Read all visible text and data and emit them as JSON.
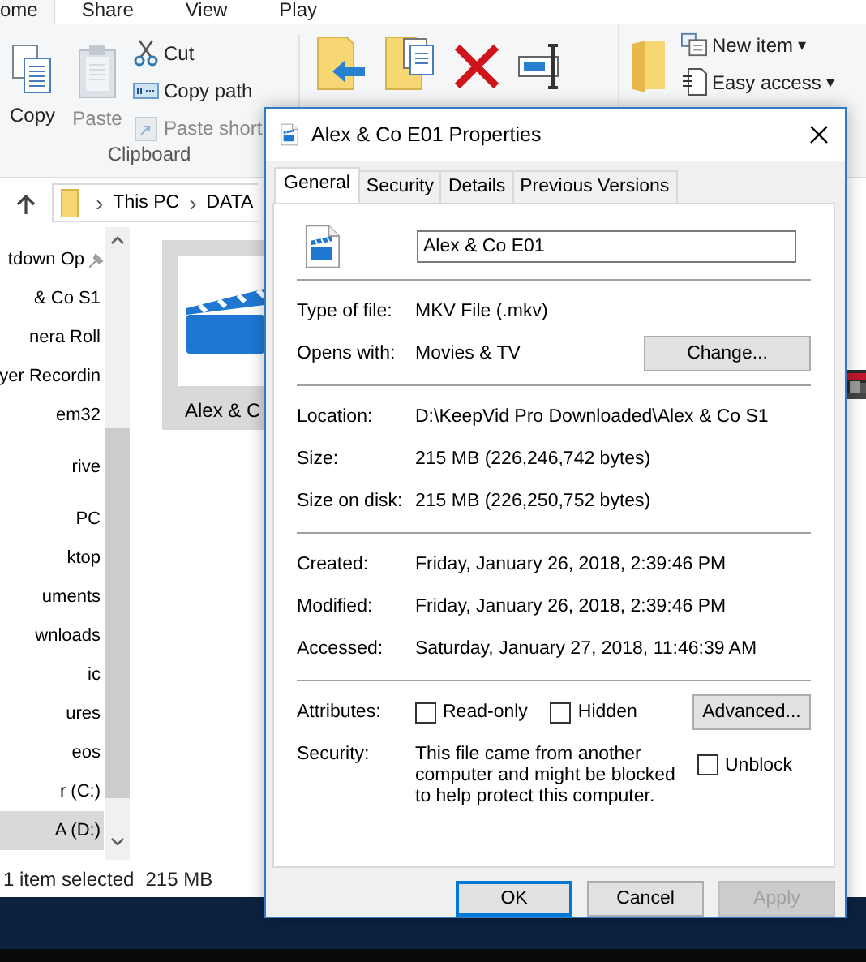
{
  "explorer": {
    "ribbon_tabs": [
      {
        "label": "ome",
        "selected": true
      },
      {
        "label": "Share",
        "selected": false
      },
      {
        "label": "View",
        "selected": false
      },
      {
        "label": "Play",
        "selected": false
      }
    ],
    "clipboard": {
      "large": [
        {
          "label": "Copy",
          "disabled": false
        },
        {
          "label": "Paste",
          "disabled": true
        }
      ],
      "small": [
        {
          "label": "Cut",
          "disabled": false
        },
        {
          "label": "Copy path",
          "disabled": false
        },
        {
          "label": "Paste short",
          "disabled": true
        }
      ],
      "group_label": "Clipboard"
    },
    "new_group": [
      {
        "label": "New item",
        "caret": "▾"
      },
      {
        "label": "Easy access",
        "caret": "▾"
      }
    ],
    "breadcrumbs": [
      {
        "separator": "›",
        "label": "This PC"
      },
      {
        "separator": "›",
        "label": "DATA"
      }
    ],
    "nav_groups": [
      [
        {
          "label": "tdown Op",
          "pinned": true,
          "selected": false
        },
        {
          "label": "& Co S1",
          "pinned": false,
          "selected": false
        },
        {
          "label": "nera Roll",
          "pinned": false,
          "selected": false
        },
        {
          "label": "yer Recordin",
          "pinned": false,
          "selected": false
        },
        {
          "label": "em32",
          "pinned": false,
          "selected": false
        }
      ],
      [
        {
          "label": "rive",
          "pinned": false,
          "selected": false
        }
      ],
      [
        {
          "label": "PC",
          "pinned": false,
          "selected": false
        },
        {
          "label": "ktop",
          "pinned": false,
          "selected": false
        },
        {
          "label": "uments",
          "pinned": false,
          "selected": false
        },
        {
          "label": "wnloads",
          "pinned": false,
          "selected": false
        },
        {
          "label": "ic",
          "pinned": false,
          "selected": false
        },
        {
          "label": "ures",
          "pinned": false,
          "selected": false
        },
        {
          "label": "eos",
          "pinned": false,
          "selected": false
        },
        {
          "label": "r (C:)",
          "pinned": false,
          "selected": false
        },
        {
          "label": "A (D:)",
          "pinned": false,
          "selected": true
        }
      ]
    ],
    "files": [
      {
        "name": "Alex & C",
        "selected": true
      }
    ],
    "status_bar": {
      "count": "1 item selected",
      "size": "215 MB"
    }
  },
  "dialog": {
    "title": "Alex & Co E01 Properties",
    "tabs": [
      {
        "label": "General",
        "selected": true
      },
      {
        "label": "Security",
        "selected": false
      },
      {
        "label": "Details",
        "selected": false
      },
      {
        "label": "Previous Versions",
        "selected": false
      }
    ],
    "name_field": {
      "value": "Alex & Co E01"
    },
    "sections": [
      [
        {
          "label": "Type of file:",
          "value": "MKV File (.mkv)"
        },
        {
          "label": "Opens with:",
          "value": "Movies & TV",
          "button": "Change..."
        }
      ],
      [
        {
          "label": "Location:",
          "value": "D:\\KeepVid Pro Downloaded\\Alex & Co S1"
        },
        {
          "label": "Size:",
          "value": "215 MB (226,246,742 bytes)"
        },
        {
          "label": "Size on disk:",
          "value": "215 MB (226,250,752 bytes)"
        }
      ],
      [
        {
          "label": "Created:",
          "value": "Friday, January 26, 2018, 2:39:46 PM"
        },
        {
          "label": "Modified:",
          "value": "Friday, January 26, 2018, 2:39:46 PM"
        },
        {
          "label": "Accessed:",
          "value": "Saturday, January 27, 2018, 11:46:39 AM"
        }
      ]
    ],
    "attributes": {
      "label": "Attributes:",
      "checkboxes": [
        {
          "label": "Read-only",
          "checked": false
        },
        {
          "label": "Hidden",
          "checked": false
        }
      ],
      "button": "Advanced..."
    },
    "security": {
      "label": "Security:",
      "text": "This file came from another computer and might be blocked to help protect this computer.",
      "unblock": {
        "label": "Unblock",
        "checked": false
      }
    },
    "buttons": [
      {
        "label": "OK",
        "default": true,
        "disabled": false
      },
      {
        "label": "Cancel",
        "default": false,
        "disabled": false
      },
      {
        "label": "Apply",
        "default": false,
        "disabled": true
      }
    ]
  }
}
